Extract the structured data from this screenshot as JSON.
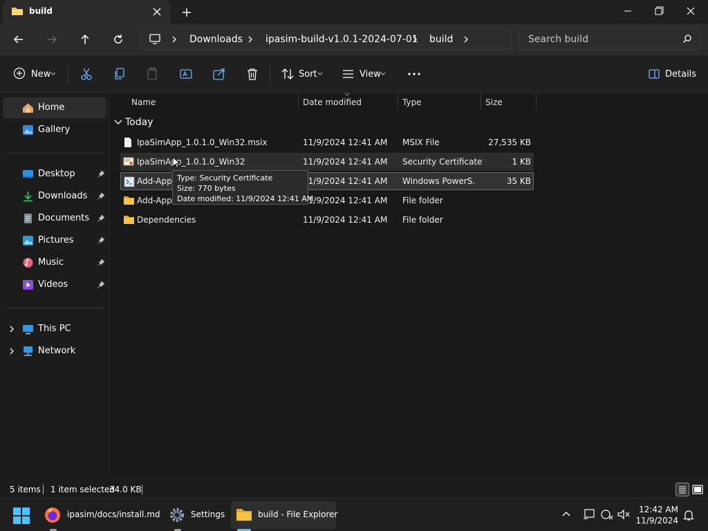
{
  "window": {
    "tab_title": "build",
    "colors": {
      "accent": "#f5c542",
      "selection_border": "#6a6a6a"
    }
  },
  "address": {
    "crumbs": [
      "Downloads",
      "ipasim-build-v1.0.1-2024-07-01",
      "build"
    ],
    "search_placeholder": "Search build"
  },
  "toolbar": {
    "new_label": "New",
    "sort_label": "Sort",
    "view_label": "View",
    "details_label": "Details"
  },
  "sidebar": {
    "items": [
      {
        "label": "Home",
        "icon": "home-icon",
        "selected": true
      },
      {
        "label": "Gallery",
        "icon": "gallery-icon"
      },
      {
        "label": "Desktop",
        "icon": "desktop-icon",
        "pinned": true
      },
      {
        "label": "Downloads",
        "icon": "download-icon",
        "pinned": true
      },
      {
        "label": "Documents",
        "icon": "documents-icon",
        "pinned": true
      },
      {
        "label": "Pictures",
        "icon": "pictures-icon",
        "pinned": true
      },
      {
        "label": "Music",
        "icon": "music-icon",
        "pinned": true
      },
      {
        "label": "Videos",
        "icon": "videos-icon",
        "pinned": true
      },
      {
        "label": "This PC",
        "icon": "pc-icon",
        "expandable": true
      },
      {
        "label": "Network",
        "icon": "network-icon",
        "expandable": true
      }
    ]
  },
  "files": {
    "columns": {
      "name": "Name",
      "date": "Date modified",
      "type": "Type",
      "size": "Size"
    },
    "group_label": "Today",
    "rows": [
      {
        "name": "IpaSimApp_1.0.1.0_Win32.msix",
        "date": "11/9/2024 12:41 AM",
        "type": "MSIX File",
        "size": "27,535 KB",
        "icon": "file-icon"
      },
      {
        "name": "IpaSimApp_1.0.1.0_Win32",
        "date": "11/9/2024 12:41 AM",
        "type": "Security Certificate",
        "size": "1 KB",
        "icon": "certificate-icon"
      },
      {
        "name": "Add-Appl",
        "date": "11/9/2024 12:41 AM",
        "type": "Windows PowerS...",
        "size": "35 KB",
        "icon": "powershell-script-icon"
      },
      {
        "name": "Add-Appl",
        "date": "11/9/2024 12:41 AM",
        "type": "File folder",
        "size": "",
        "icon": "folder-icon"
      },
      {
        "name": "Dependencies",
        "date": "11/9/2024 12:41 AM",
        "type": "File folder",
        "size": "",
        "icon": "folder-icon"
      }
    ]
  },
  "tooltip": {
    "type_line": "Type: Security Certificate",
    "size_line": "Size: 770 bytes",
    "date_line": "Date modified: 11/9/2024 12:41 AM"
  },
  "status": {
    "item_count": "5 items",
    "selection": "1 item selected",
    "selection_size": "34.0 KB"
  },
  "taskbar": {
    "firefox_label": "ipasim/docs/install.md",
    "settings_label": "Settings",
    "explorer_label": "build - File Explorer",
    "time": "12:42 AM",
    "date": "11/9/2024"
  }
}
